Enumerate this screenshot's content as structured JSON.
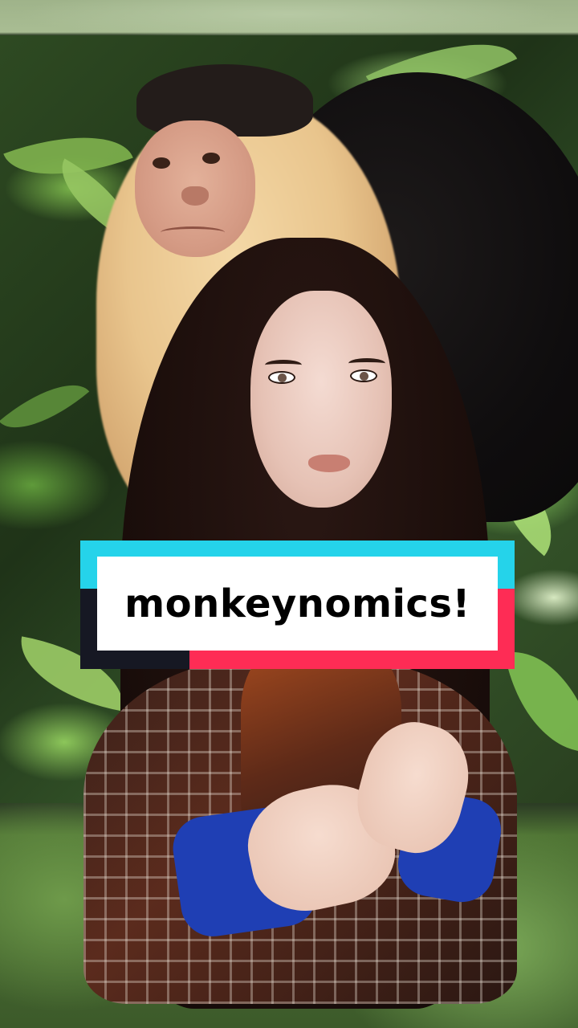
{
  "video": {
    "caption": "monkeynomics!"
  },
  "colors": {
    "caption_cyan": "#25d3ea",
    "caption_red": "#fe2c55",
    "caption_dark": "#161823",
    "caption_box": "#ffffff",
    "caption_text": "#000000"
  }
}
